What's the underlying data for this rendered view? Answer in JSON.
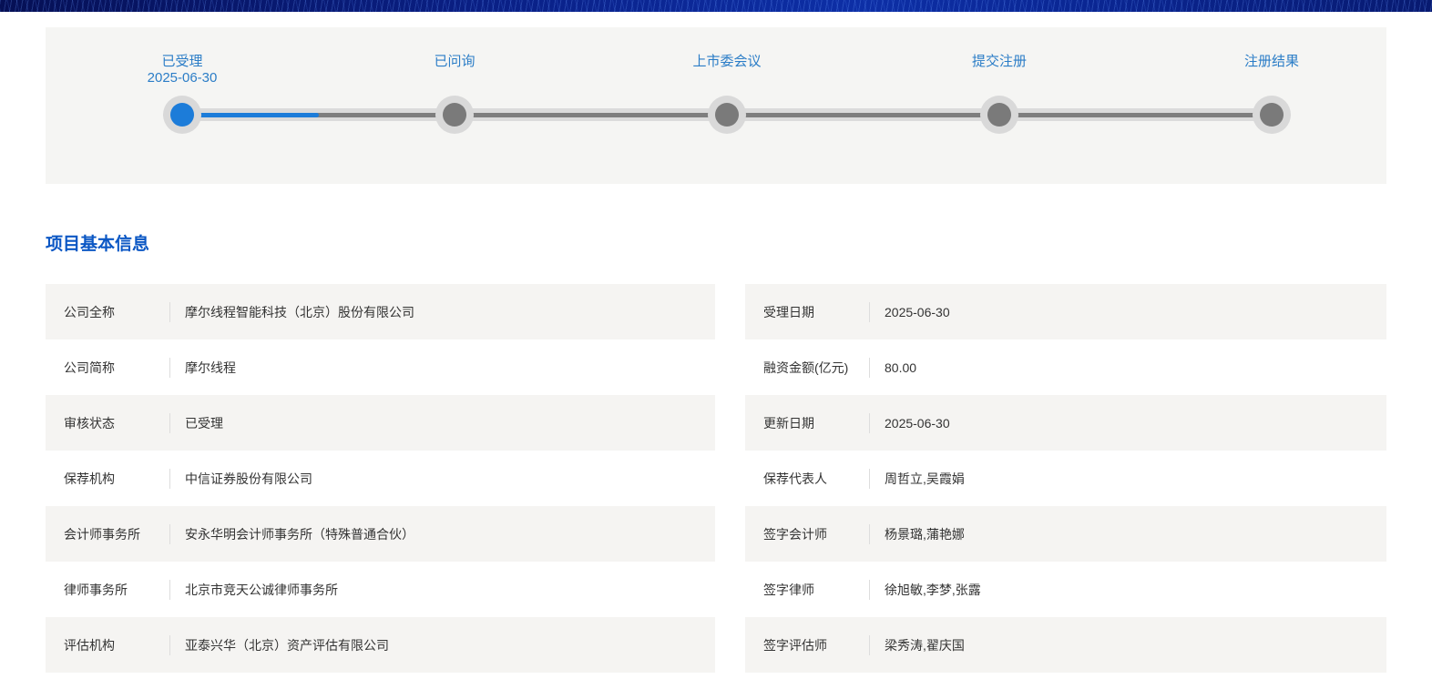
{
  "banner": {
    "base_color": "#0a2086"
  },
  "timeline": {
    "steps": [
      {
        "label": "已受理",
        "date": "2025-06-30",
        "state": "active"
      },
      {
        "label": "已问询",
        "date": "",
        "state": "pending"
      },
      {
        "label": "上市委会议",
        "date": "",
        "state": "pending"
      },
      {
        "label": "提交注册",
        "date": "",
        "state": "pending"
      },
      {
        "label": "注册结果",
        "date": "",
        "state": "pending"
      }
    ],
    "progress_segment": 0.5,
    "progress_color": "#1c7cd9",
    "label_color": "#2b7dc7"
  },
  "section": {
    "title": "项目基本信息"
  },
  "info": {
    "left_rows": [
      {
        "label": "公司全称",
        "value": "摩尔线程智能科技（北京）股份有限公司"
      },
      {
        "label": "公司简称",
        "value": "摩尔线程"
      },
      {
        "label": "审核状态",
        "value": "已受理"
      },
      {
        "label": "保荐机构",
        "value": "中信证券股份有限公司"
      },
      {
        "label": "会计师事务所",
        "value": "安永华明会计师事务所（特殊普通合伙）"
      },
      {
        "label": "律师事务所",
        "value": "北京市竞天公诚律师事务所"
      },
      {
        "label": "评估机构",
        "value": "亚泰兴华（北京）资产评估有限公司"
      }
    ],
    "right_rows": [
      {
        "label": "受理日期",
        "value": "2025-06-30"
      },
      {
        "label": "融资金额(亿元)",
        "value": "80.00"
      },
      {
        "label": "更新日期",
        "value": "2025-06-30"
      },
      {
        "label": "保荐代表人",
        "value": "周哲立,吴霞娟"
      },
      {
        "label": "签字会计师",
        "value": "杨景璐,蒲艳娜"
      },
      {
        "label": "签字律师",
        "value": "徐旭敏,李梦,张露"
      },
      {
        "label": "签字评估师",
        "value": "梁秀涛,翟庆国"
      }
    ]
  },
  "colors": {
    "title_blue": "#0b57c4",
    "row_stripe": "#f5f4f2",
    "panel_bg": "#f5f5f3",
    "track_gray": "#dbdbdb",
    "line_gray": "#7e7e7e"
  }
}
